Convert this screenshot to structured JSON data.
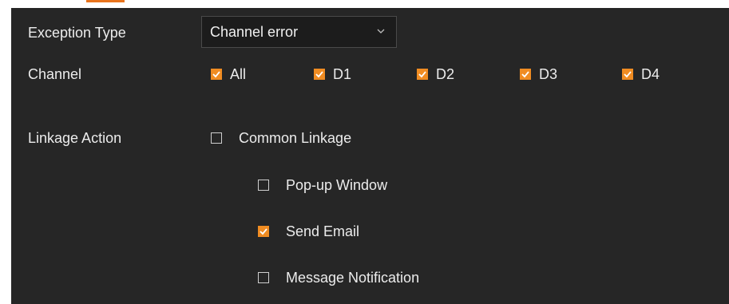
{
  "form": {
    "exception_type_label": "Exception Type",
    "exception_type_value": "Channel error",
    "channel_label": "Channel",
    "channels": [
      {
        "label": "All",
        "checked": true
      },
      {
        "label": "D1",
        "checked": true
      },
      {
        "label": "D2",
        "checked": true
      },
      {
        "label": "D3",
        "checked": true
      },
      {
        "label": "D4",
        "checked": true
      }
    ],
    "linkage_label": "Linkage Action",
    "common_linkage": {
      "label": "Common Linkage",
      "checked": false
    },
    "sub_actions": [
      {
        "label": "Pop-up Window",
        "checked": false
      },
      {
        "label": "Send Email",
        "checked": true
      },
      {
        "label": "Message Notification",
        "checked": false
      }
    ]
  },
  "colors": {
    "accent": "#f08c22",
    "panel_bg": "#262626",
    "text": "#ececec"
  },
  "icons": {
    "dropdown": "chevron-down-icon",
    "checkbox_checked": "checkbox-checked-icon",
    "checkbox_unchecked": "checkbox-unchecked-icon"
  }
}
